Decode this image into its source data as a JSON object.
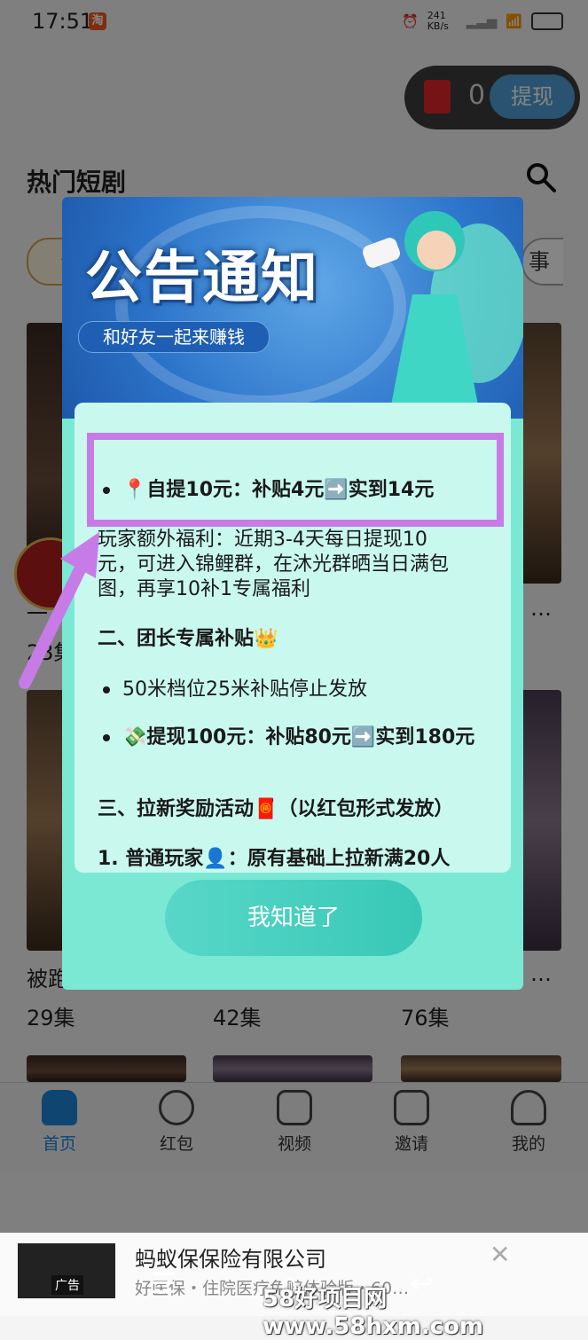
{
  "status_bar": {
    "time": "17:51",
    "taobao_badge": "淘",
    "net_speed": "241 KB/s"
  },
  "wallet": {
    "balance": "0",
    "withdraw_label": "提现"
  },
  "section_title": "热门短剧",
  "chips": {
    "left_partial": "全",
    "right_partial": "事"
  },
  "grid": {
    "row1": [
      {
        "title_partial": "一",
        "episodes": "23集"
      },
      {
        "episodes": ""
      },
      {
        "title_partial": "…"
      }
    ],
    "row2": [
      {
        "title_partial": "被跑",
        "episodes": "29集"
      },
      {
        "episodes": "42集"
      },
      {
        "title_partial": "…",
        "episodes": "76集"
      }
    ]
  },
  "modal": {
    "banner_title": "公告通知",
    "banner_subtitle": "和好友一起来赚钱",
    "highlighted_item": "📍自提10元：补贴4元➡️实到14元",
    "para1": [
      "玩家额外福利：近期3-4天每日提现10",
      "元，可进入锦鲤群，在沐光群晒当日满包",
      "图，再享10补1专属福利"
    ],
    "section2_title": "二、团长专属补贴👑",
    "section2_items": [
      "50米档位25米补贴停止发放",
      "💸提现100元：补贴80元➡️实到180元"
    ],
    "section3_title": "三、拉新奖励活动🧧（以红包形式发放）",
    "section3_cut": "1. 普通玩家👤：原有基础上拉新满20人",
    "ok_button": "我知道了"
  },
  "nav": [
    {
      "label": "首页",
      "icon": "home-icon",
      "active": true
    },
    {
      "label": "红包",
      "icon": "redpacket-icon"
    },
    {
      "label": "视频",
      "icon": "video-icon"
    },
    {
      "label": "邀请",
      "icon": "invite-icon"
    },
    {
      "label": "我的",
      "icon": "profile-icon"
    }
  ],
  "ad": {
    "tag": "广告",
    "title": "蚂蚁保保险有限公司",
    "subtitle": "好医保・住院医疗免赔体验版・60…"
  },
  "watermark": "58好项目网www.58hxm.com",
  "colors": {
    "accent": "#1b86d8",
    "modal_bg": "#7be8d4",
    "highlight": "#c77be6"
  }
}
